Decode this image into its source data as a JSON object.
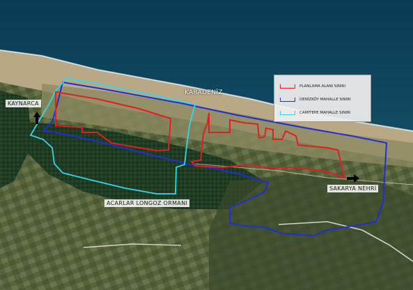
{
  "labels": {
    "karadeniz": "KARADENİZ",
    "kaynarca": "KAYNARCA",
    "sakarya": "SAKARYA NEHRİ",
    "longoz": "ACARLAR LONGOZ ORMANI"
  },
  "legend": [
    {
      "label": "PLANLAMA ALANI SINIRI",
      "color": "#e02020"
    },
    {
      "label": "DENİZKÖY MAHALLE SINIRI",
      "color": "#1f2fd0"
    },
    {
      "label": "CAMİTEPE MAHALLE SINIRI",
      "color": "#35d6e8"
    }
  ],
  "colors": {
    "sea_deep": "#0b3850",
    "sea_shallow": "#2a7a86",
    "beach": "#b7a684",
    "forest": "#1f3a20",
    "farmland": "#4a5a32",
    "planlama": "#e02020",
    "denizkoy": "#1f2fd0",
    "camitepe": "#35d6e8"
  }
}
